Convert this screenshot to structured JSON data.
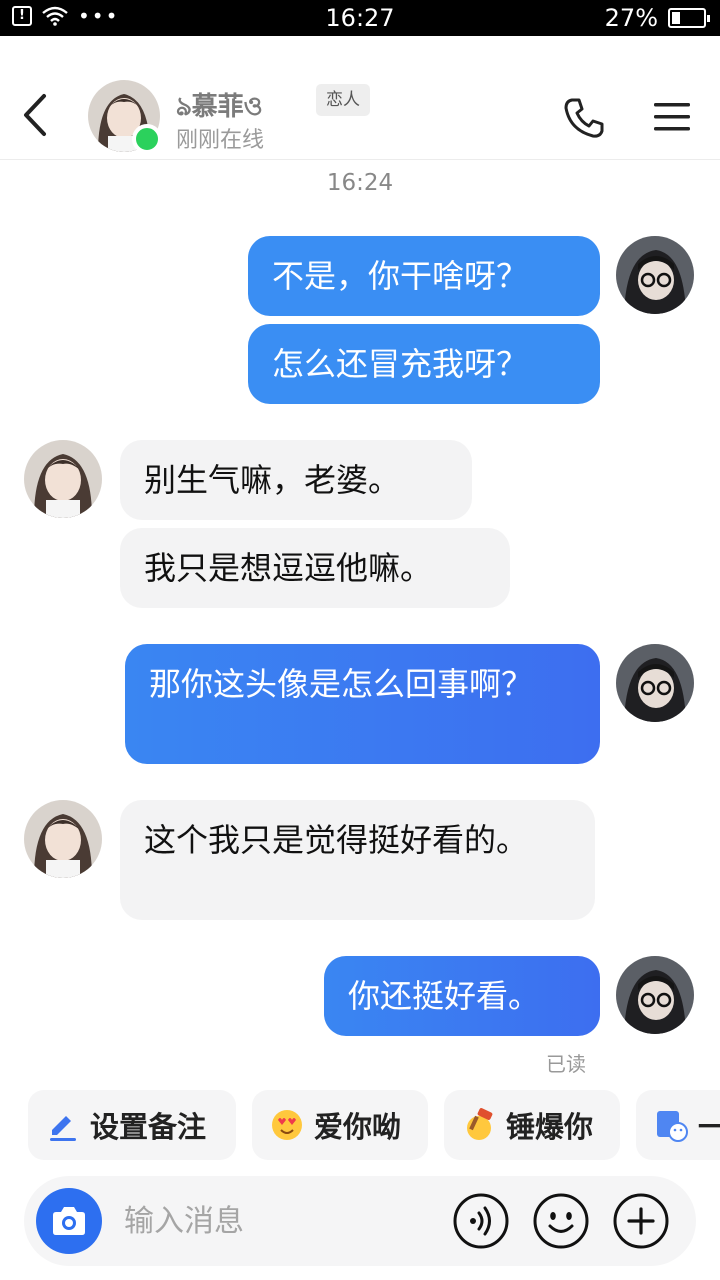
{
  "status_bar": {
    "time": "16:27",
    "battery": "27%",
    "battery_level": 0.27,
    "dots": "•••",
    "alert_glyph": "!"
  },
  "header": {
    "contact_name": "ঌ慕菲ও",
    "relationship_tag": "恋人",
    "presence": "刚刚在线",
    "icons": {
      "back": "chevron-left-icon",
      "call": "phone-icon",
      "menu": "hamburger-menu-icon"
    }
  },
  "conversation": {
    "timestamp": "16:24",
    "messages": [
      {
        "direction": "out",
        "text": "不是，你干啥呀？"
      },
      {
        "direction": "out",
        "text": "怎么还冒充我呀？"
      },
      {
        "direction": "in",
        "text": "别生气嘛，老婆。"
      },
      {
        "direction": "in",
        "text": "我只是想逗逗他嘛。"
      },
      {
        "direction": "out",
        "text": "那你这头像是怎么回事啊？"
      },
      {
        "direction": "in",
        "text": "这个我只是觉得挺好看的。"
      },
      {
        "direction": "out",
        "text": "你还挺好看。"
      }
    ],
    "read_receipt": "已读"
  },
  "quick_actions": [
    {
      "label": "设置备注",
      "icon": "pencil-icon"
    },
    {
      "label": "爱你呦",
      "icon": "heart-eyes-emoji-icon"
    },
    {
      "label": "锤爆你",
      "icon": "hammer-emoji-icon"
    },
    {
      "label": "一",
      "icon": "sticker-icon"
    }
  ],
  "input_bar": {
    "placeholder": "输入消息",
    "icons": {
      "camera": "camera-icon",
      "voice": "voice-icon",
      "emoji": "emoji-icon",
      "more": "plus-icon"
    }
  },
  "colors": {
    "outgoing_bubble": "#3a86f2",
    "incoming_bubble": "#f3f3f4",
    "online": "#2bd15c",
    "accent": "#2d6ff0"
  }
}
